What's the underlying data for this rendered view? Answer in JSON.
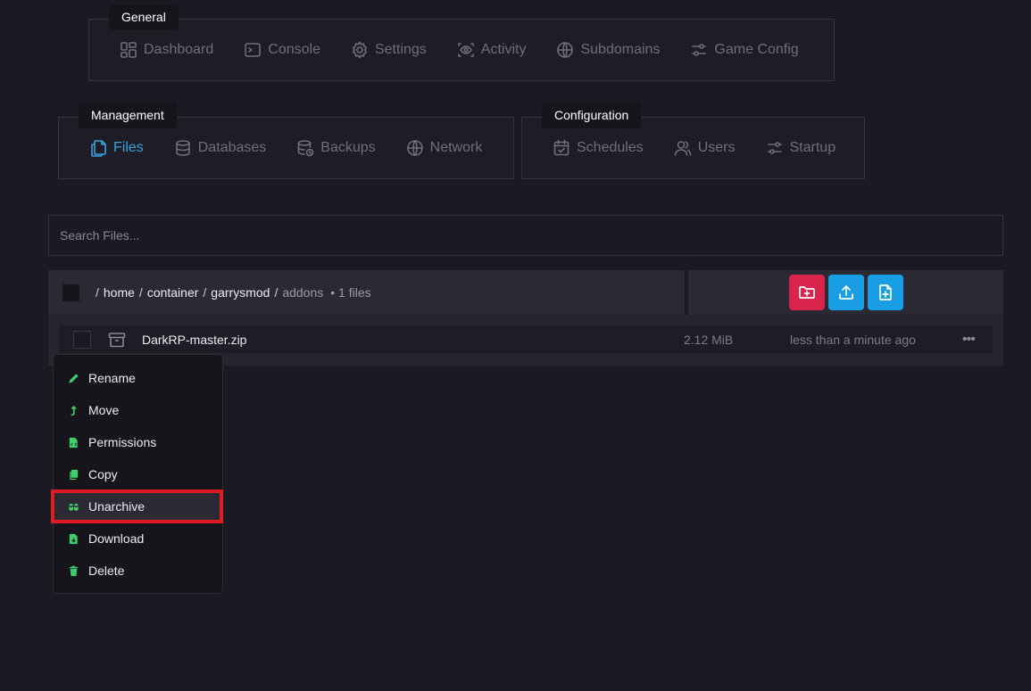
{
  "nav": {
    "general": {
      "title": "General",
      "items": [
        {
          "label": "Dashboard",
          "icon": "dashboard-icon"
        },
        {
          "label": "Console",
          "icon": "console-icon"
        },
        {
          "label": "Settings",
          "icon": "gear-icon"
        },
        {
          "label": "Activity",
          "icon": "eye-icon"
        },
        {
          "label": "Subdomains",
          "icon": "globe-icon"
        },
        {
          "label": "Game Config",
          "icon": "sliders-icon"
        }
      ]
    },
    "management": {
      "title": "Management",
      "items": [
        {
          "label": "Files",
          "icon": "files-icon",
          "active": true
        },
        {
          "label": "Databases",
          "icon": "database-icon"
        },
        {
          "label": "Backups",
          "icon": "backup-icon"
        },
        {
          "label": "Network",
          "icon": "globe-icon"
        }
      ]
    },
    "configuration": {
      "title": "Configuration",
      "items": [
        {
          "label": "Schedules",
          "icon": "calendar-icon"
        },
        {
          "label": "Users",
          "icon": "users-icon"
        },
        {
          "label": "Startup",
          "icon": "sliders-icon"
        }
      ]
    }
  },
  "search": {
    "placeholder": "Search Files..."
  },
  "path": {
    "segments": [
      "home",
      "container",
      "garrysmod",
      "addons"
    ],
    "separator": "/",
    "count": "• 1 files"
  },
  "files": [
    {
      "name": "DarkRP-master.zip",
      "size": "2.12 MiB",
      "modified": "less than a minute ago",
      "more": "•••"
    }
  ],
  "context_menu": {
    "items": [
      {
        "label": "Rename",
        "icon": "pencil-icon"
      },
      {
        "label": "Move",
        "icon": "arrow-up-icon"
      },
      {
        "label": "Permissions",
        "icon": "file-code-icon"
      },
      {
        "label": "Copy",
        "icon": "copy-icon"
      },
      {
        "label": "Unarchive",
        "icon": "boxes-icon",
        "highlighted": true
      },
      {
        "label": "Download",
        "icon": "file-download-icon"
      },
      {
        "label": "Delete",
        "icon": "trash-icon"
      }
    ]
  },
  "colors": {
    "background": "#1b1a22",
    "accent": "#3aa3e3",
    "menu_icon": "#3dd06a",
    "new_folder_button": "#d8254c",
    "upload_button": "#1a9ee3",
    "highlight_border": "#e01b24"
  }
}
